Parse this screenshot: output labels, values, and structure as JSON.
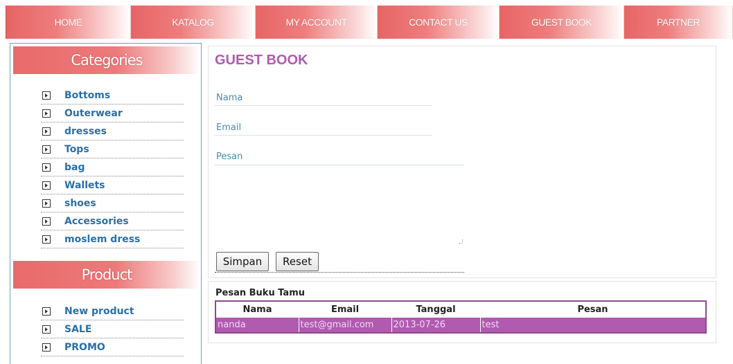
{
  "nav": [
    {
      "label": "HOME"
    },
    {
      "label": "KATALOG"
    },
    {
      "label": "MY ACCOUNT"
    },
    {
      "label": "CONTACT US"
    },
    {
      "label": "GUEST BOOK"
    },
    {
      "label": "PARTNER"
    }
  ],
  "sidebar": {
    "categories_title": "Categories",
    "categories": [
      "Bottoms",
      "Outerwear",
      "dresses",
      "Tops",
      "bag",
      "Wallets",
      "shoes",
      "Accessories",
      "moslem dress"
    ],
    "product_title": "Product",
    "products": [
      "New product",
      "SALE",
      "PROMO"
    ]
  },
  "form": {
    "title": "GUEST BOOK",
    "nama_label": "Nama",
    "email_label": "Email",
    "pesan_label": "Pesan",
    "save_label": "Simpan",
    "reset_label": "Reset"
  },
  "guestbook": {
    "title": "Pesan Buku Tamu",
    "columns": [
      "Nama",
      "Email",
      "Tanggal",
      "Pesan"
    ],
    "rows": [
      [
        "nanda",
        "test@gmail.com",
        "2013-07-26",
        "test"
      ]
    ]
  },
  "colors": {
    "nav_red": "#e86a6a",
    "title_purple": "#b05ab0",
    "link_blue": "#2a6fa8",
    "row_purple": "#b05ab0"
  }
}
